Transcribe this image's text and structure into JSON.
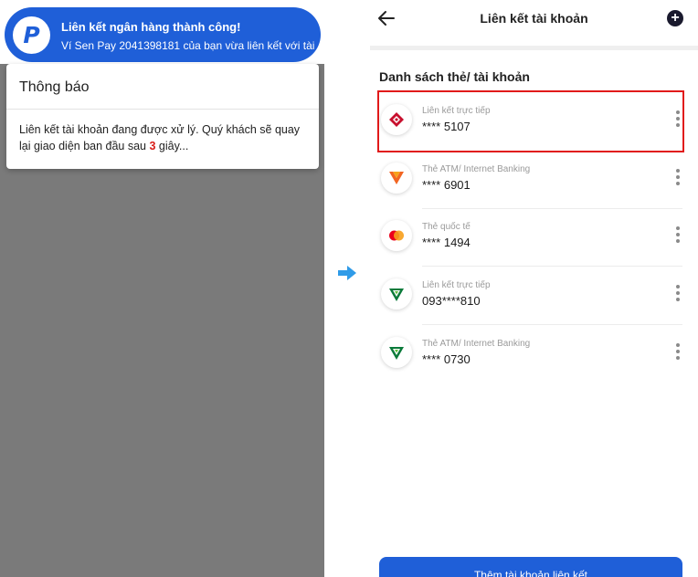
{
  "left": {
    "toast": {
      "logo_letter": "P",
      "title": "Liên kết ngân hàng thành công!",
      "message": "Ví Sen Pay 2041398181 của bạn vừa liên kết với tài..."
    },
    "dialog": {
      "title": "Thông báo",
      "body_prefix": "Liên kết tài khoản đang được xử lý. Quý khách sẽ quay lại giao diện ban đầu sau ",
      "countdown": "3",
      "body_suffix": " giây..."
    }
  },
  "right": {
    "header": {
      "title": "Liên kết tài khoản"
    },
    "section_title": "Danh sách thẻ/ tài khoản",
    "accounts": [
      {
        "type": "Liên kết trực tiếp",
        "number": "**** 5107",
        "icon": "diamond-bank-icon",
        "selected": true
      },
      {
        "type": "Thẻ ATM/ Internet Banking",
        "number": "**** 6901",
        "icon": "vp-bank-icon",
        "selected": false
      },
      {
        "type": "Thẻ quốc tế",
        "number": "**** 1494",
        "icon": "mastercard-icon",
        "selected": false
      },
      {
        "type": "Liên kết trực tiếp",
        "number": "093****810",
        "icon": "vcb-bank-icon",
        "selected": false
      },
      {
        "type": "Thẻ ATM/ Internet Banking",
        "number": "**** 0730",
        "icon": "vcb-bank-icon",
        "selected": false
      }
    ],
    "add_button": "Thêm tài khoản liên kết"
  },
  "colors": {
    "brand_blue": "#1f5fd8",
    "highlight_red": "#e11a1a",
    "countdown_red": "#d91e18"
  }
}
